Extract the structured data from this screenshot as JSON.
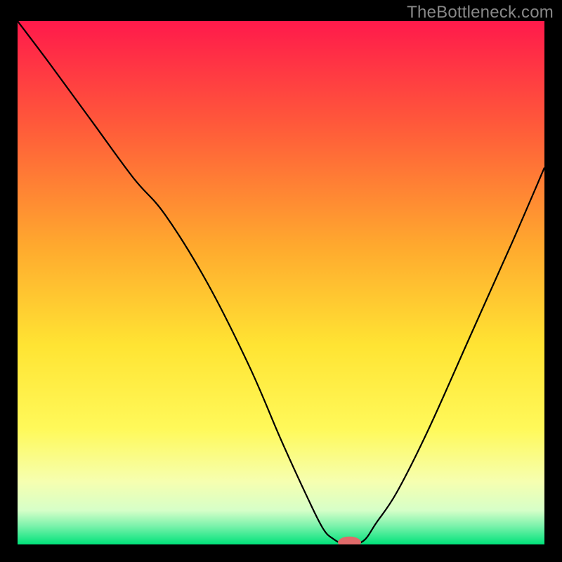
{
  "watermark": "TheBottleneck.com",
  "chart_data": {
    "type": "line",
    "title": "",
    "xlabel": "",
    "ylabel": "",
    "xlim": [
      0,
      100
    ],
    "ylim": [
      0,
      100
    ],
    "grid": false,
    "legend": false,
    "background_gradient_stops": [
      {
        "offset": 0,
        "color": "#ff1a4b"
      },
      {
        "offset": 0.2,
        "color": "#ff5a3a"
      },
      {
        "offset": 0.43,
        "color": "#ffa92e"
      },
      {
        "offset": 0.62,
        "color": "#ffe433"
      },
      {
        "offset": 0.78,
        "color": "#fff95a"
      },
      {
        "offset": 0.88,
        "color": "#f6ffb0"
      },
      {
        "offset": 0.935,
        "color": "#d6ffc8"
      },
      {
        "offset": 0.965,
        "color": "#7af2ab"
      },
      {
        "offset": 1.0,
        "color": "#00e27a"
      }
    ],
    "series": [
      {
        "name": "bottleneck-curve",
        "color": "#000000",
        "x": [
          0,
          6,
          14,
          22,
          28,
          36,
          44,
          50,
          55,
          58,
          60,
          62,
          64,
          66,
          68,
          72,
          78,
          86,
          94,
          100
        ],
        "y": [
          100,
          92,
          81,
          70,
          63,
          50,
          34,
          20,
          9,
          3,
          1,
          0,
          0,
          1,
          4,
          10,
          22,
          40,
          58,
          72
        ]
      }
    ],
    "marker": {
      "name": "optimal-point",
      "x": 63,
      "y": 0,
      "rx": 2.2,
      "ry": 1.1,
      "color": "#e06a6a"
    }
  }
}
